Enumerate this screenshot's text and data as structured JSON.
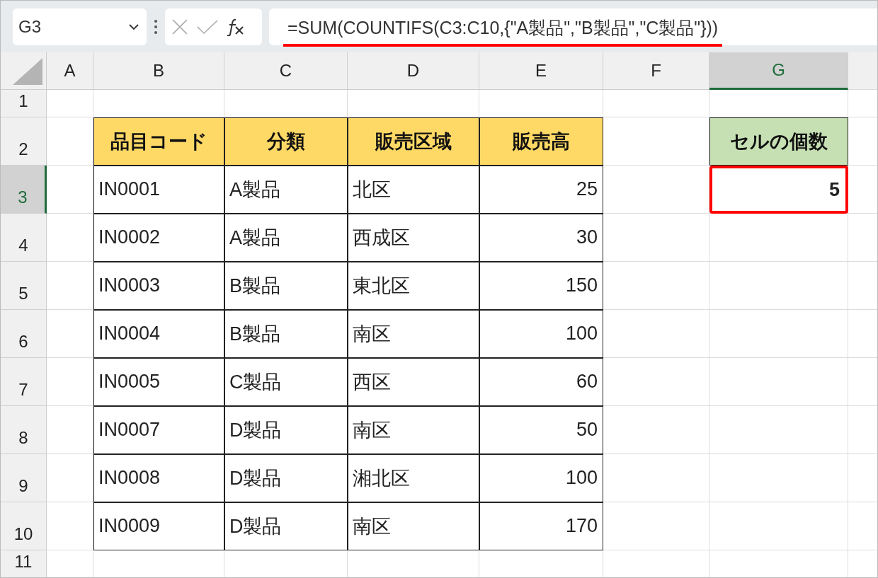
{
  "formula_bar": {
    "name_box": "G3",
    "formula": "=SUM(COUNTIFS(C3:C10,{\"A製品\",\"B製品\",\"C製品\"}))",
    "underlined": true
  },
  "sheet": {
    "columns": [
      {
        "label": "A",
        "selected": false
      },
      {
        "label": "B",
        "selected": false
      },
      {
        "label": "C",
        "selected": false
      },
      {
        "label": "D",
        "selected": false
      },
      {
        "label": "E",
        "selected": false
      },
      {
        "label": "F",
        "selected": false
      },
      {
        "label": "G",
        "selected": true
      }
    ],
    "rows": [
      {
        "label": "1",
        "selected": false
      },
      {
        "label": "2",
        "selected": false
      },
      {
        "label": "3",
        "selected": true
      },
      {
        "label": "4",
        "selected": false
      },
      {
        "label": "5",
        "selected": false
      },
      {
        "label": "6",
        "selected": false
      },
      {
        "label": "7",
        "selected": false
      },
      {
        "label": "8",
        "selected": false
      },
      {
        "label": "9",
        "selected": false
      },
      {
        "label": "10",
        "selected": false
      },
      {
        "label": "11",
        "selected": false
      }
    ]
  },
  "table": {
    "headers": [
      "品目コード",
      "分類",
      "販売区域",
      "販売高"
    ],
    "rows": [
      [
        "IN0001",
        "A製品",
        "北区",
        "25"
      ],
      [
        "IN0002",
        "A製品",
        "西成区",
        "30"
      ],
      [
        "IN0003",
        "B製品",
        "東北区",
        "150"
      ],
      [
        "IN0004",
        "B製品",
        "南区",
        "100"
      ],
      [
        "IN0005",
        "C製品",
        "西区",
        "60"
      ],
      [
        "IN0007",
        "D製品",
        "南区",
        "50"
      ],
      [
        "IN0008",
        "D製品",
        "湘北区",
        "100"
      ],
      [
        "IN0009",
        "D製品",
        "南区",
        "170"
      ]
    ]
  },
  "result": {
    "header": "セルの個数",
    "value": "5",
    "highlighted": true
  }
}
